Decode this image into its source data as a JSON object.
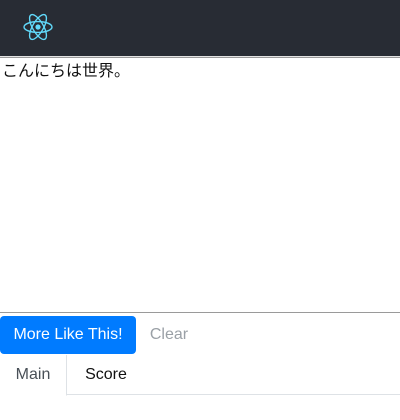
{
  "navbar": {
    "logo_icon": "react-atom-icon",
    "logo_color": "#61dafb",
    "background": "#282c34"
  },
  "editor": {
    "text": "こんにちは世界。"
  },
  "actions": {
    "primary_label": "More Like This!",
    "primary_color": "#007bff",
    "clear_label": "Clear"
  },
  "tabs": [
    {
      "label": "Main",
      "active": true
    },
    {
      "label": "Score",
      "active": false
    }
  ]
}
